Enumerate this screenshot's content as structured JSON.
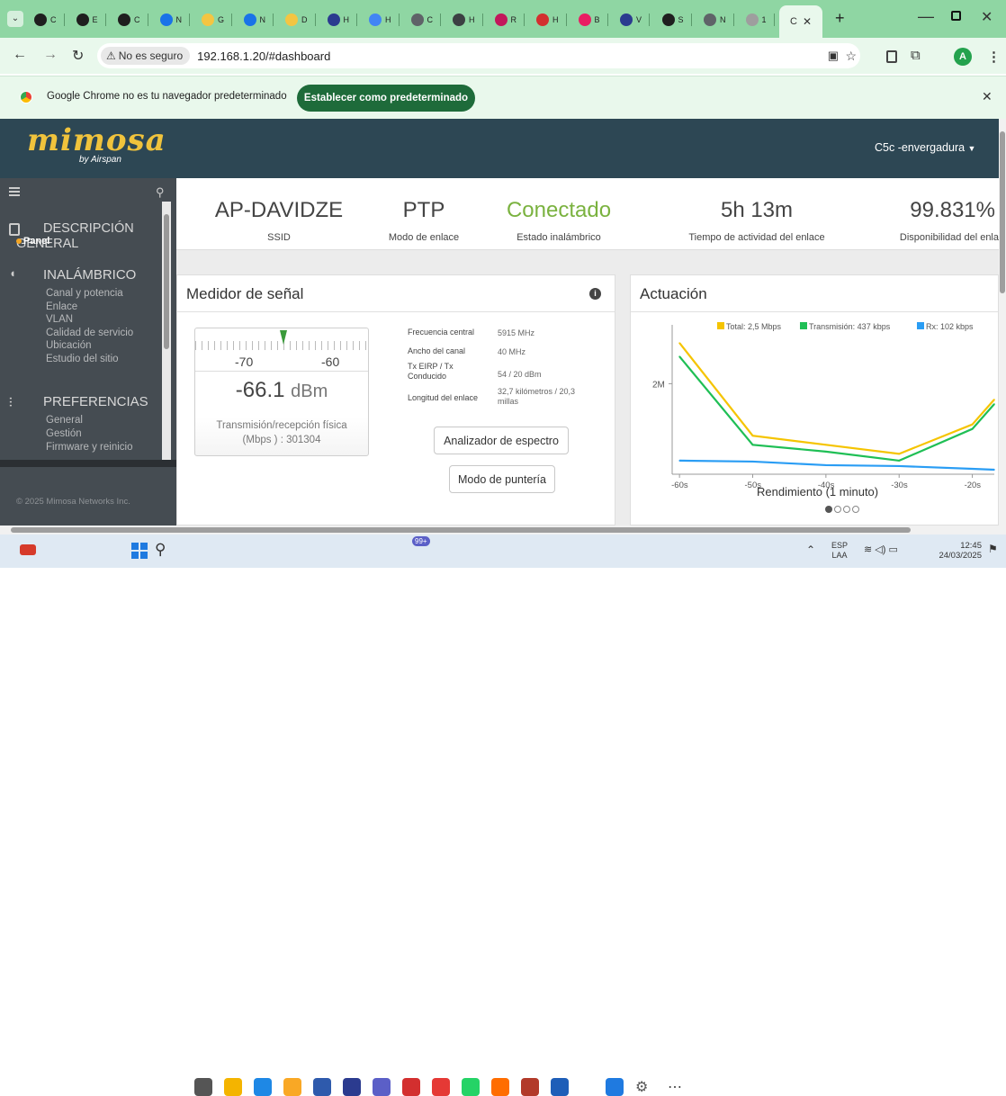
{
  "browser": {
    "tabs": [
      {
        "label": "C",
        "color": "#1f1f1f"
      },
      {
        "label": "E",
        "color": "#1f1f1f"
      },
      {
        "label": "C",
        "color": "#1f1f1f"
      },
      {
        "label": "N",
        "color": "#1a73e8"
      },
      {
        "label": "G",
        "color": "#f4c542"
      },
      {
        "label": "N",
        "color": "#1a73e8"
      },
      {
        "label": "D",
        "color": "#f4c542"
      },
      {
        "label": "H",
        "color": "#2b3b8f"
      },
      {
        "label": "H",
        "color": "#4285f4"
      },
      {
        "label": "C",
        "color": "#5f6368"
      },
      {
        "label": "H",
        "color": "#3c4043"
      },
      {
        "label": "R",
        "color": "#c2185b"
      },
      {
        "label": "H",
        "color": "#d32f2f"
      },
      {
        "label": "B",
        "color": "#e91e63"
      },
      {
        "label": "V",
        "color": "#2b3b8f"
      },
      {
        "label": "S",
        "color": "#1f1f1f"
      },
      {
        "label": "N",
        "color": "#5f6368"
      },
      {
        "label": "1",
        "color": "#9e9e9e"
      }
    ],
    "active_tab": {
      "label": "C"
    },
    "security_label": "No es seguro",
    "url": "192.168.1.20/#dashboard",
    "profile_initial": "A",
    "infobar_text": "Google Chrome no es tu navegador predeterminado",
    "infobar_button": "Establecer como predeterminado"
  },
  "app": {
    "logo": "mimosa",
    "logo_sub": "by Airspan",
    "device_menu": "C5c -envergadura",
    "copyright": "© 2025 Mimosa Networks Inc.",
    "nav": {
      "overview": "DESCRIPCIÓN GENERAL",
      "overview_active_sub": "Panel",
      "wireless": "INALÁMBRICO",
      "wireless_items": [
        "Canal y potencia",
        "Enlace",
        "VLAN",
        "Calidad de servicio",
        "Ubicación",
        "Estudio del sitio"
      ],
      "preferences": "PREFERENCIAS",
      "preferences_items": [
        "General",
        "Gestión",
        "Firmware y reinicio"
      ]
    }
  },
  "stats": [
    {
      "value": "AP-DAVIDZE",
      "label": "SSID"
    },
    {
      "value": "PTP",
      "label": "Modo de enlace"
    },
    {
      "value": "Conectado",
      "label": "Estado inalámbrico",
      "color": "#7ab23f"
    },
    {
      "value": "5h 13m",
      "label": "Tiempo de actividad del enlace"
    },
    {
      "value": "99.831%",
      "label": "Disponibilidad del enla"
    }
  ],
  "signal": {
    "title": "Medidor de señal",
    "scale_left": "-70",
    "scale_right": "-60",
    "value": "-66.1",
    "unit": "dBm",
    "phy_label": "Transmisión/recepción física",
    "phy_value": "(Mbps ) : 301304",
    "details": [
      {
        "label": "Frecuencia central",
        "value": "5915 MHz"
      },
      {
        "label": "Ancho del canal",
        "value": "40 MHz"
      },
      {
        "label": "Tx EIRP / Tx Conducido",
        "value": "54 / 20 dBm"
      },
      {
        "label": "Longitud del enlace",
        "value": "32,7 kilómetros / 20,3 millas"
      }
    ],
    "spectrum_button": "Analizador de espectro",
    "aim_button": "Modo de puntería"
  },
  "performance": {
    "title": "Actuación",
    "xlabel": "Rendimiento (1 minuto)",
    "chart_data": {
      "type": "line",
      "xlabel": "Rendimiento (1 minuto)",
      "x_ticks": [
        "-60s",
        "-50s",
        "-40s",
        "-30s",
        "-20s"
      ],
      "y_ticks": [
        "2M"
      ],
      "x": [
        -60,
        -50,
        -40,
        -30,
        -20,
        -17
      ],
      "series": [
        {
          "name": "Total: 2,5 Mbps",
          "color": "#f5c400",
          "values": [
            2.9,
            0.85,
            0.65,
            0.45,
            1.1,
            1.65
          ]
        },
        {
          "name": "Transmisión: 437 kbps",
          "color": "#1fbf55",
          "values": [
            2.6,
            0.65,
            0.5,
            0.3,
            1.0,
            1.55
          ]
        },
        {
          "name": "Rx: 102 kbps",
          "color": "#2a9df4",
          "values": [
            0.3,
            0.28,
            0.2,
            0.18,
            0.12,
            0.1
          ]
        }
      ],
      "ylim": [
        0,
        3.3
      ]
    }
  },
  "taskbar": {
    "lang": "ESP",
    "lang_sub": "LAA",
    "time": "12:45",
    "date": "24/03/2025",
    "badge": "99+"
  }
}
